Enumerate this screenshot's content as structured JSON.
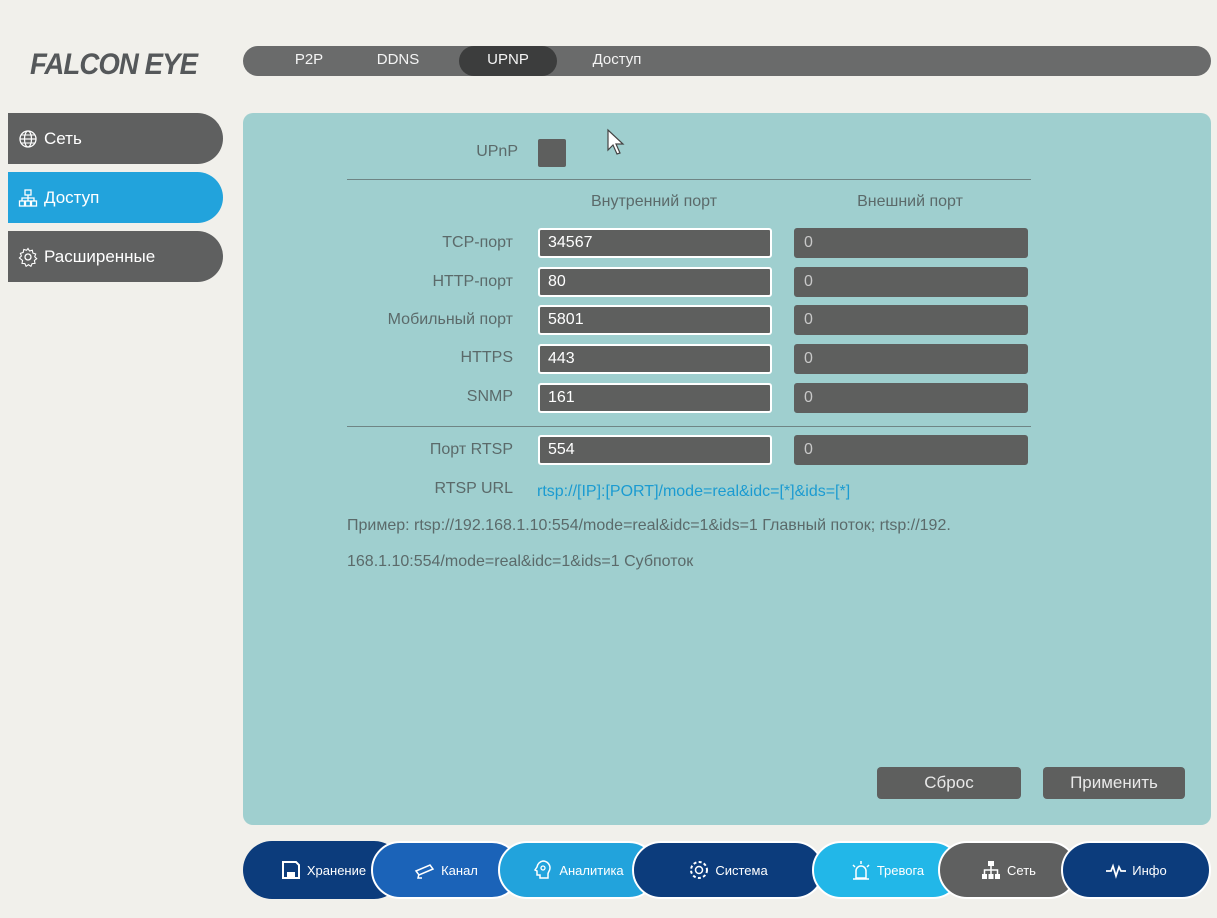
{
  "brand": "FALCON EYE",
  "top_tabs": [
    {
      "label": "P2P"
    },
    {
      "label": "DDNS"
    },
    {
      "label": "UPNP"
    },
    {
      "label": "Доступ"
    }
  ],
  "sidebar": {
    "items": [
      {
        "label": "Сеть",
        "icon": "globe-icon"
      },
      {
        "label": "Доступ",
        "icon": "network-icon"
      },
      {
        "label": "Расширенные",
        "icon": "gear-icon"
      }
    ]
  },
  "upnp": {
    "label": "UPnP",
    "checked": false
  },
  "columns": {
    "internal": "Внутренний порт",
    "external": "Внешний порт"
  },
  "ports": [
    {
      "label": "TCP-порт",
      "internal": "34567",
      "external": "0"
    },
    {
      "label": "HTTP-порт",
      "internal": "80",
      "external": "0"
    },
    {
      "label": "Мобильный порт",
      "internal": "5801",
      "external": "0"
    },
    {
      "label": "HTTPS",
      "internal": "443",
      "external": "0"
    },
    {
      "label": "SNMP",
      "internal": "161",
      "external": "0"
    }
  ],
  "rtsp": {
    "label": "Порт RTSP",
    "internal": "554",
    "external": "0",
    "url_label": "RTSP URL",
    "url": "rtsp://[IP]:[PORT]/mode=real&idc=[*]&ids=[*]",
    "example_line1": "Пример: rtsp://192.168.1.10:554/mode=real&idc=1&ids=1 Главный поток; rtsp://192.",
    "example_line2": "168.1.10:554/mode=real&idc=1&ids=1 Субпоток"
  },
  "buttons": {
    "reset": "Сброс",
    "apply": "Применить"
  },
  "bottom_nav": [
    {
      "label": "Хранение",
      "icon": "floppy-icon",
      "color": "#0c3c7c"
    },
    {
      "label": "Канал",
      "icon": "camera-icon",
      "color": "#1b63b8"
    },
    {
      "label": "Аналитика",
      "icon": "analytics-icon",
      "color": "#22a3dc"
    },
    {
      "label": "Система",
      "icon": "gear-icon",
      "color": "#0c3c7c"
    },
    {
      "label": "Тревога",
      "icon": "alarm-icon",
      "color": "#22b7e8"
    },
    {
      "label": "Сеть",
      "icon": "network-icon",
      "color": "#5f6060"
    },
    {
      "label": "Инфо",
      "icon": "pulse-icon",
      "color": "#0c3c7c"
    }
  ]
}
